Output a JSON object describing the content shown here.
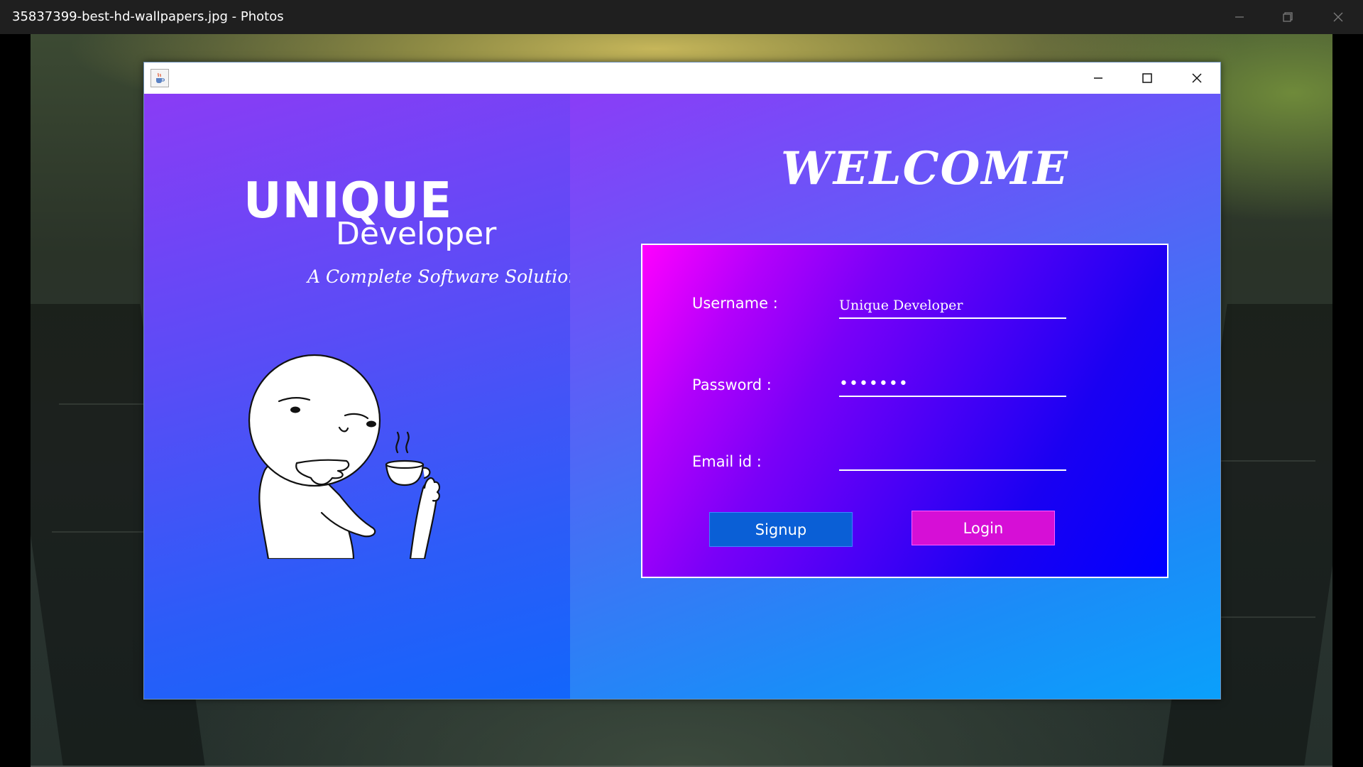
{
  "photos": {
    "window_title": "35837399-best-hd-wallpapers.jpg - Photos"
  },
  "app": {
    "brand": {
      "title": "UNIQUE",
      "subtitle": "Developer",
      "tagline": "A Complete Software Solution"
    },
    "welcome": "WELCOME",
    "form": {
      "username_label": "Username :",
      "username_value": "Unique Developer",
      "password_label": "Password  :",
      "password_value": "•••••••",
      "email_label": "Email id :",
      "email_value": "",
      "signup_label": "Signup",
      "login_label": "Login"
    },
    "colors": {
      "signup_button": "#0a5fd6",
      "login_button": "#d60fd6",
      "form_gradient_start": "#ff00ff",
      "form_gradient_end": "#0000ff"
    }
  }
}
